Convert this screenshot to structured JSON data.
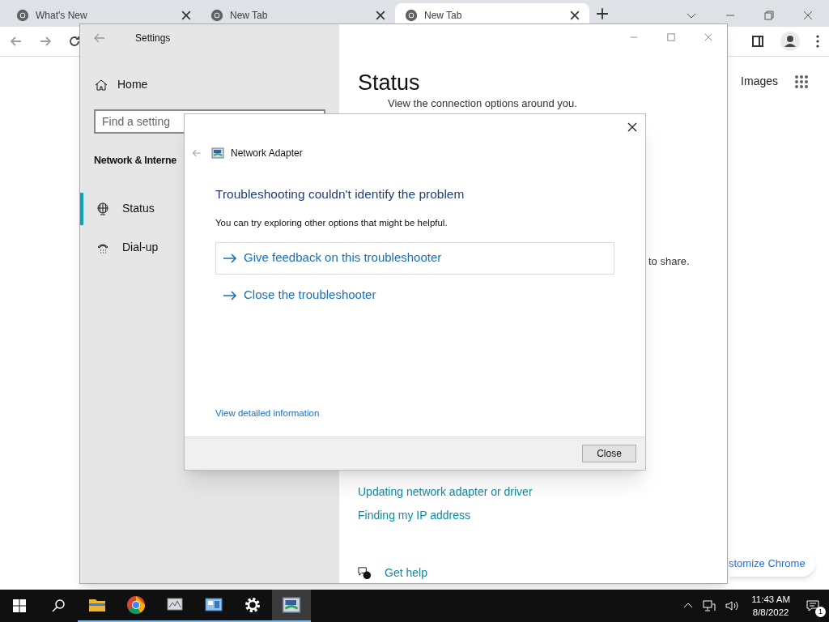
{
  "browser": {
    "tabs": [
      {
        "title": "What's New",
        "selected": false
      },
      {
        "title": "New Tab",
        "selected": false
      },
      {
        "title": "New Tab",
        "selected": true
      }
    ],
    "images_link": "Images",
    "customize_button": "stomize Chrome"
  },
  "settings": {
    "title": "Settings",
    "home": "Home",
    "search": {
      "placeholder": "Find a setting"
    },
    "section": "Network & Interne",
    "nav": [
      {
        "label": "Status",
        "kind": "globe",
        "selected": true
      },
      {
        "label": "Dial-up",
        "kind": "phone",
        "selected": false
      }
    ],
    "heading": "Status",
    "subtitle": "View the connection options around you.",
    "partial_text": "to share.",
    "help_links": [
      "Updating network adapter or driver",
      "Finding my IP address"
    ],
    "get_help": "Get help"
  },
  "dialog": {
    "title": "Network Adapter",
    "heading": "Troubleshooting couldn't identify the problem",
    "message": "You can try exploring other options that might be helpful.",
    "options": [
      {
        "label": "Give feedback on this troubleshooter",
        "kind": "boxed"
      },
      {
        "label": "Close the troubleshooter",
        "kind": "plain"
      }
    ],
    "details_link": "View detailed information",
    "button": "Close"
  },
  "taskbar": {
    "apps": [
      {
        "kind": "explorer",
        "running": true,
        "selected": false
      },
      {
        "kind": "chrome",
        "running": true,
        "selected": false
      },
      {
        "kind": "monitor",
        "running": true,
        "selected": false
      },
      {
        "kind": "panel",
        "running": true,
        "selected": false
      },
      {
        "kind": "settings",
        "running": true,
        "selected": false
      },
      {
        "kind": "adapter",
        "running": true,
        "selected": true
      }
    ],
    "time": "11:43 AM",
    "date": "8/8/2022",
    "notifications": "1"
  }
}
